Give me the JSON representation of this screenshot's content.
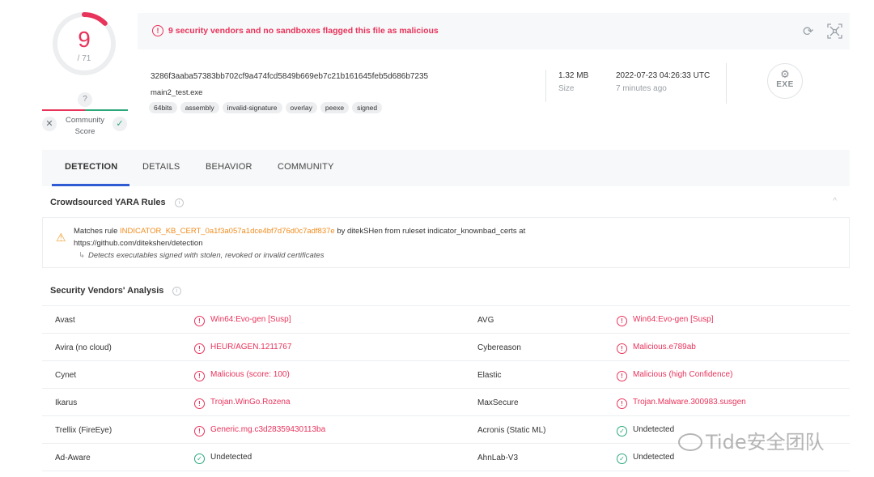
{
  "score": {
    "detections": "9",
    "total": "/ 71",
    "malicious_fraction": 0.127,
    "community_icon": "question-icon",
    "community_label_1": "Community",
    "community_label_2": "Score"
  },
  "banner": {
    "message": "9 security vendors and no sandboxes flagged this file as malicious"
  },
  "file": {
    "hash": "3286f3aaba57383bb702cf9a474fcd5849b669eb7c21b161645feb5d686b7235",
    "name": "main2_test.exe",
    "tags": [
      "64bits",
      "assembly",
      "invalid-signature",
      "overlay",
      "peexe",
      "signed"
    ],
    "size": "1.32 MB",
    "size_label": "Size",
    "date": "2022-07-23 04:26:33 UTC",
    "date_label": "7 minutes ago",
    "type_badge": "EXE"
  },
  "tabs": [
    "DETECTION",
    "DETAILS",
    "BEHAVIOR",
    "COMMUNITY"
  ],
  "yara": {
    "title": "Crowdsourced YARA Rules",
    "prefix": "Matches rule ",
    "rule": "INDICATOR_KB_CERT_0a1f3a057a1dce4bf7d76d0c7adf837e",
    "suffix": " by ditekSHen from ruleset indicator_knownbad_certs at",
    "url": "https://github.com/ditekshen/detection",
    "description": "Detects executables signed with stolen, revoked or invalid certificates"
  },
  "vendors": {
    "title": "Security Vendors' Analysis",
    "rows": [
      {
        "left_name": "Avast",
        "left_result": "Win64:Evo-gen [Susp]",
        "left_status": "mal",
        "right_name": "AVG",
        "right_result": "Win64:Evo-gen [Susp]",
        "right_status": "mal"
      },
      {
        "left_name": "Avira (no cloud)",
        "left_result": "HEUR/AGEN.1211767",
        "left_status": "mal",
        "right_name": "Cybereason",
        "right_result": "Malicious.e789ab",
        "right_status": "mal"
      },
      {
        "left_name": "Cynet",
        "left_result": "Malicious (score: 100)",
        "left_status": "mal",
        "right_name": "Elastic",
        "right_result": "Malicious (high Confidence)",
        "right_status": "mal"
      },
      {
        "left_name": "Ikarus",
        "left_result": "Trojan.WinGo.Rozena",
        "left_status": "mal",
        "right_name": "MaxSecure",
        "right_result": "Trojan.Malware.300983.susgen",
        "right_status": "mal"
      },
      {
        "left_name": "Trellix (FireEye)",
        "left_result": "Generic.mg.c3d28359430113ba",
        "left_status": "mal",
        "right_name": "Acronis (Static ML)",
        "right_result": "Undetected",
        "right_status": "ok"
      },
      {
        "left_name": "Ad-Aware",
        "left_result": "Undetected",
        "left_status": "ok",
        "right_name": "AhnLab-V3",
        "right_result": "Undetected",
        "right_status": "ok"
      }
    ]
  },
  "watermark": {
    "text": "Tide安全团队"
  },
  "colors": {
    "malicious": "#e8335b",
    "clean": "#2aa87a",
    "rule": "#f08c1e",
    "tab_accent": "#2f5bd3"
  }
}
